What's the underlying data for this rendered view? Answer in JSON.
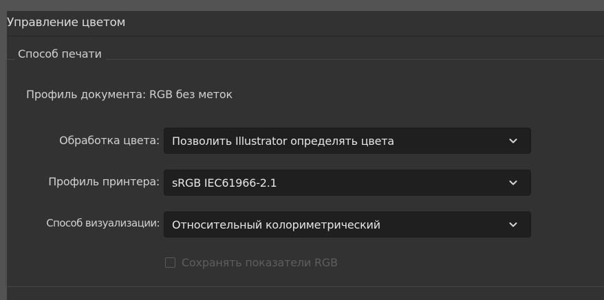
{
  "panel": {
    "title": "Управление цветом"
  },
  "group": {
    "legend": "Способ печати",
    "document_profile": "Профиль документа: RGB без меток"
  },
  "fields": {
    "color_handling": {
      "label": "Обработка цвета:",
      "value": "Позволить Illustrator определять цвета"
    },
    "printer_profile": {
      "label": "Профиль принтера:",
      "value": "sRGB IEC61966-2.1"
    },
    "rendering_intent": {
      "label": "Способ визуализации:",
      "value": "Относительный колориметрический"
    }
  },
  "preserve_rgb": {
    "label": "Сохранять показатели RGB",
    "checked": false,
    "disabled": true
  },
  "icons": {
    "dropdown": "chevron-down-icon"
  },
  "colors": {
    "background": "#535353",
    "panel": "#323232",
    "field": "#1f1f1f",
    "text": "#d0d0d0",
    "disabled_text": "#5e5e5e"
  }
}
